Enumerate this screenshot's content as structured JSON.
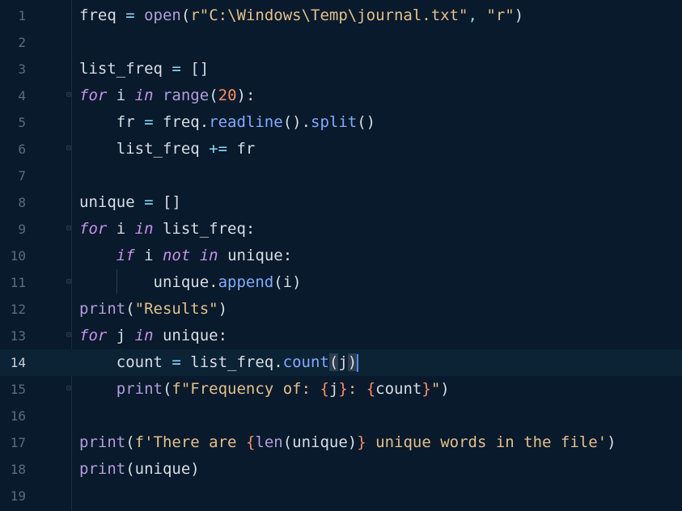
{
  "editor": {
    "current_line": 14,
    "lines": [
      {
        "n": "1",
        "tokens": [
          [
            "pm",
            "freq "
          ],
          [
            "op",
            "= "
          ],
          [
            "bi",
            "open"
          ],
          [
            "pm",
            "("
          ],
          [
            "str",
            "r\"C:\\Windows\\Temp\\journal.txt\""
          ],
          [
            "op",
            ", "
          ],
          [
            "str",
            "\"r\""
          ],
          [
            "pm",
            ")"
          ]
        ]
      },
      {
        "n": "2",
        "tokens": []
      },
      {
        "n": "3",
        "tokens": [
          [
            "pm",
            "list_freq "
          ],
          [
            "op",
            "= "
          ],
          [
            "pm",
            "[]"
          ]
        ]
      },
      {
        "n": "4",
        "tokens": [
          [
            "kw",
            "for "
          ],
          [
            "pm",
            "i "
          ],
          [
            "kw",
            "in "
          ],
          [
            "bi",
            "range"
          ],
          [
            "pm",
            "("
          ],
          [
            "num",
            "20"
          ],
          [
            "pm",
            "):"
          ]
        ]
      },
      {
        "n": "5",
        "tokens": [
          [
            "pm",
            "    fr "
          ],
          [
            "op",
            "= "
          ],
          [
            "pm",
            "freq."
          ],
          [
            "fn",
            "readline"
          ],
          [
            "pm",
            "()."
          ],
          [
            "fn",
            "split"
          ],
          [
            "pm",
            "()"
          ]
        ]
      },
      {
        "n": "6",
        "tokens": [
          [
            "pm",
            "    list_freq "
          ],
          [
            "op",
            "+= "
          ],
          [
            "pm",
            "fr"
          ]
        ]
      },
      {
        "n": "7",
        "tokens": []
      },
      {
        "n": "8",
        "tokens": [
          [
            "pm",
            "unique "
          ],
          [
            "op",
            "= "
          ],
          [
            "pm",
            "[]"
          ]
        ]
      },
      {
        "n": "9",
        "tokens": [
          [
            "kw",
            "for "
          ],
          [
            "pm",
            "i "
          ],
          [
            "kw",
            "in "
          ],
          [
            "pm",
            "list_freq:"
          ]
        ]
      },
      {
        "n": "10",
        "tokens": [
          [
            "pm",
            "    "
          ],
          [
            "kw",
            "if "
          ],
          [
            "pm",
            "i "
          ],
          [
            "kw",
            "not in "
          ],
          [
            "pm",
            "unique:"
          ]
        ]
      },
      {
        "n": "11",
        "tokens": [
          [
            "pm",
            "        unique."
          ],
          [
            "fn",
            "append"
          ],
          [
            "pm",
            "(i)"
          ]
        ]
      },
      {
        "n": "12",
        "tokens": [
          [
            "bi",
            "print"
          ],
          [
            "pm",
            "("
          ],
          [
            "str",
            "\"Results\""
          ],
          [
            "pm",
            ")"
          ]
        ]
      },
      {
        "n": "13",
        "tokens": [
          [
            "kw",
            "for "
          ],
          [
            "pm",
            "j "
          ],
          [
            "kw",
            "in "
          ],
          [
            "pm",
            "unique:"
          ]
        ]
      },
      {
        "n": "14",
        "tokens": [
          [
            "pm",
            "    count "
          ],
          [
            "op",
            "= "
          ],
          [
            "pm",
            "list_freq."
          ],
          [
            "fn",
            "count"
          ],
          [
            "hl",
            "("
          ],
          [
            "pm",
            "j"
          ],
          [
            "hl",
            ")"
          ],
          [
            "caret",
            ""
          ]
        ]
      },
      {
        "n": "15",
        "tokens": [
          [
            "pm",
            "    "
          ],
          [
            "bi",
            "print"
          ],
          [
            "pm",
            "("
          ],
          [
            "str",
            "f\"Frequency of: "
          ],
          [
            "brace",
            "{"
          ],
          [
            "pm",
            "j"
          ],
          [
            "brace",
            "}"
          ],
          [
            "str",
            ": "
          ],
          [
            "brace",
            "{"
          ],
          [
            "pm",
            "count"
          ],
          [
            "brace",
            "}"
          ],
          [
            "str",
            "\""
          ],
          [
            "pm",
            ")"
          ]
        ]
      },
      {
        "n": "16",
        "tokens": []
      },
      {
        "n": "17",
        "tokens": [
          [
            "bi",
            "print"
          ],
          [
            "pm",
            "("
          ],
          [
            "str",
            "f'There are "
          ],
          [
            "brace",
            "{"
          ],
          [
            "bi",
            "len"
          ],
          [
            "pm",
            "(unique)"
          ],
          [
            "brace",
            "}"
          ],
          [
            "str",
            " unique words in the file'"
          ],
          [
            "pm",
            ")"
          ]
        ]
      },
      {
        "n": "18",
        "tokens": [
          [
            "bi",
            "print"
          ],
          [
            "pm",
            "(unique)"
          ]
        ]
      },
      {
        "n": "19",
        "tokens": []
      }
    ],
    "fold_lines": [
      4,
      6,
      9,
      11,
      13,
      15
    ]
  },
  "icons": {
    "intention_bulb": "lightbulb-icon",
    "fold_marker": "fold-marker-icon"
  },
  "colors": {
    "background": "#081a2b",
    "current_line": "#0c2235",
    "keyword": "#c792ea",
    "function": "#82aaff",
    "string": "#e2c08d",
    "number": "#f78c6c",
    "caret": "#528bff",
    "bulb": "#f2c94c"
  }
}
